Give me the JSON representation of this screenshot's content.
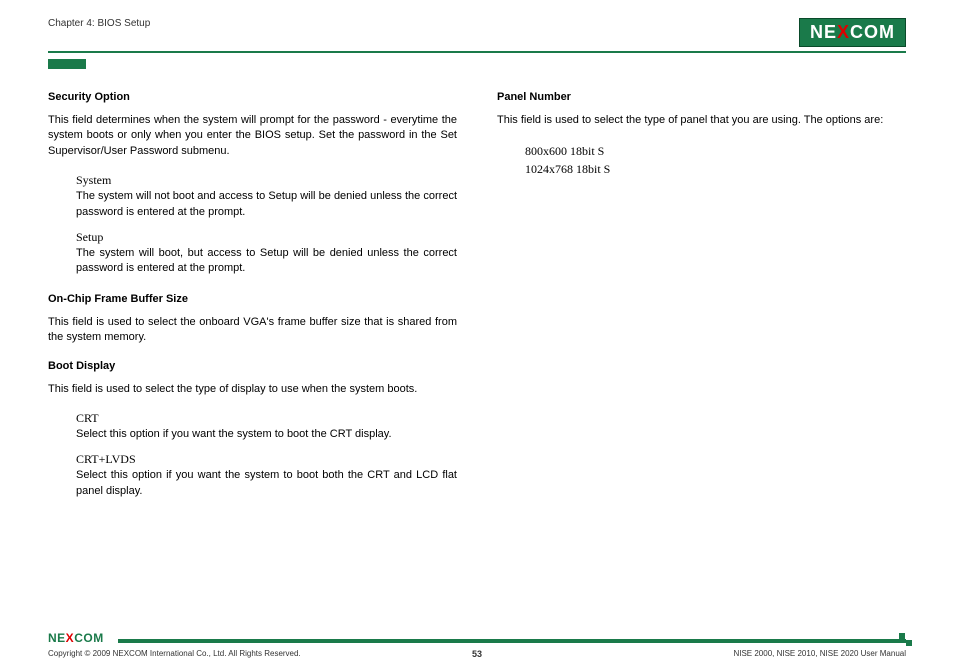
{
  "header": {
    "chapter": "Chapter 4: BIOS Setup",
    "logo_pre": "NE",
    "logo_x": "X",
    "logo_post": "COM"
  },
  "left": {
    "security": {
      "title": "Security Option",
      "body": "This field determines when the system will prompt for the password - everytime the system boots or only when you enter the BIOS setup. Set the password in the Set Supervisor/User Password submenu.",
      "opt1_label": "System",
      "opt1_desc": "The system will not boot and access to Setup will be denied unless the correct password is entered at the prompt.",
      "opt2_label": "Setup",
      "opt2_desc": "The system will boot, but access to Setup will be denied unless the correct password is entered at the prompt."
    },
    "buffer": {
      "title": "On-Chip Frame Buffer Size",
      "body": "This field is used to select the onboard VGA's frame buffer size that is shared from the system memory."
    },
    "boot": {
      "title": "Boot Display",
      "body": "This field is used to select the type of display to use when the system boots.",
      "opt1_label": "CRT",
      "opt1_desc": "Select this option if you want the system to boot the CRT display.",
      "opt2_label": "CRT+LVDS",
      "opt2_desc": "Select this option if you want the system to boot both the CRT and LCD flat panel display."
    }
  },
  "right": {
    "panel": {
      "title": "Panel Number",
      "body": "This field is used to select the type of panel that you are using. The options are:",
      "opt1": "800x600 18bit S",
      "opt2": "1024x768 18bit S"
    }
  },
  "footer": {
    "logo_pre": "NE",
    "logo_x": "X",
    "logo_post": "COM",
    "copyright": "Copyright © 2009 NEXCOM International Co., Ltd. All Rights Reserved.",
    "page": "53",
    "manual": "NISE 2000, NISE 2010, NISE 2020 User Manual"
  }
}
